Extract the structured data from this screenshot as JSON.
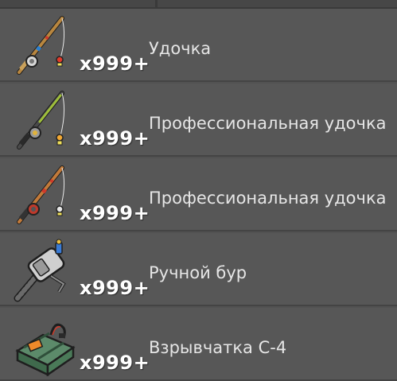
{
  "items": [
    {
      "name": "Удочка",
      "count": "x999+",
      "icon": "fishing-rod-icon"
    },
    {
      "name": "Профессиональная удочка",
      "count": "x999+",
      "icon": "pro-fishing-rod-icon"
    },
    {
      "name": "Профессиональная удочка",
      "count": "x999+",
      "icon": "pro-fishing-rod-red-icon"
    },
    {
      "name": "Ручной бур",
      "count": "x999+",
      "icon": "hand-drill-icon"
    },
    {
      "name": "Взрывчатка С-4",
      "count": "x999+",
      "icon": "c4-explosive-icon"
    }
  ]
}
